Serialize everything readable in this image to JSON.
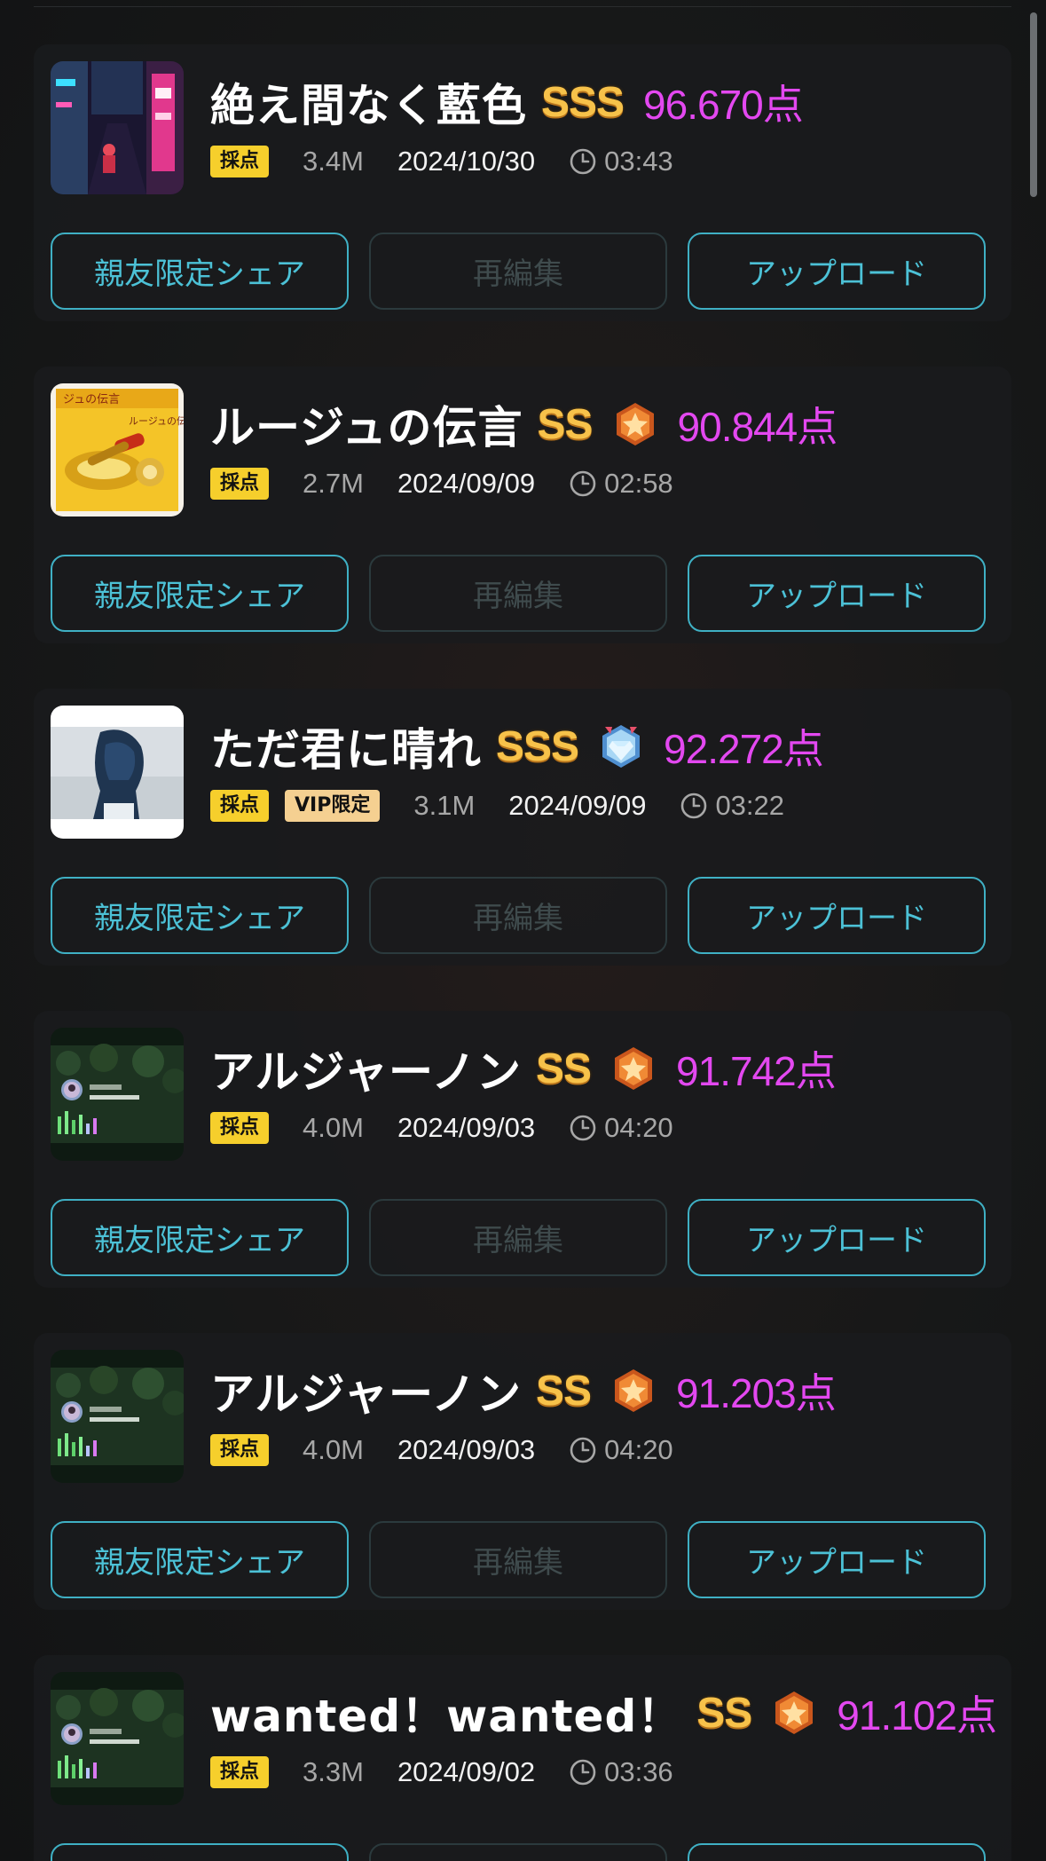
{
  "colors": {
    "score": "#e348f0",
    "rank": "#f7c24a",
    "accent_button": "#4cc1d6",
    "disabled_button": "#3f4b4d",
    "tag": "#f6cf2c",
    "vip_tag": "#f5d091"
  },
  "buttons": {
    "share_label": "親友限定シェア",
    "edit_label": "再編集",
    "upload_label": "アップロード"
  },
  "recordings": [
    {
      "title": "絶え間なく藍色",
      "rank": "SSS",
      "medal": null,
      "score": "96.670",
      "score_unit": "点",
      "tags": [
        "採点"
      ],
      "size": "3.4M",
      "date": "2024/10/30",
      "duration": "03:43",
      "thumbnail": "neon-alley-icon"
    },
    {
      "title": "ルージュの伝言",
      "rank": "SS",
      "medal": "bronze-medal-icon",
      "score": "90.844",
      "score_unit": "点",
      "tags": [
        "採点"
      ],
      "size": "2.7M",
      "date": "2024/09/09",
      "duration": "02:58",
      "thumbnail": "album-cover-icon",
      "thumbnail_text": "ルージュの伝言"
    },
    {
      "title": "ただ君に晴れ",
      "rank": "SSS",
      "medal": "diamond-medal-icon",
      "score": "92.272",
      "score_unit": "点",
      "tags": [
        "採点",
        "VIP限定"
      ],
      "size": "3.1M",
      "date": "2024/09/09",
      "duration": "03:22",
      "thumbnail": "hooded-girl-icon"
    },
    {
      "title": "アルジャーノン",
      "rank": "SS",
      "medal": "bronze-medal-icon",
      "score": "91.742",
      "score_unit": "点",
      "tags": [
        "採点"
      ],
      "size": "4.0M",
      "date": "2024/09/03",
      "duration": "04:20",
      "thumbnail": "forest-video-icon"
    },
    {
      "title": "アルジャーノン",
      "rank": "SS",
      "medal": "bronze-medal-icon",
      "score": "91.203",
      "score_unit": "点",
      "tags": [
        "採点"
      ],
      "size": "4.0M",
      "date": "2024/09/03",
      "duration": "04:20",
      "thumbnail": "forest-video-icon"
    },
    {
      "title": "wanted！wanted！",
      "rank": "SS",
      "medal": "bronze-medal-icon",
      "score": "91.102",
      "score_unit": "点",
      "tags": [
        "採点"
      ],
      "size": "3.3M",
      "date": "2024/09/02",
      "duration": "03:36",
      "thumbnail": "forest-video-icon"
    }
  ]
}
